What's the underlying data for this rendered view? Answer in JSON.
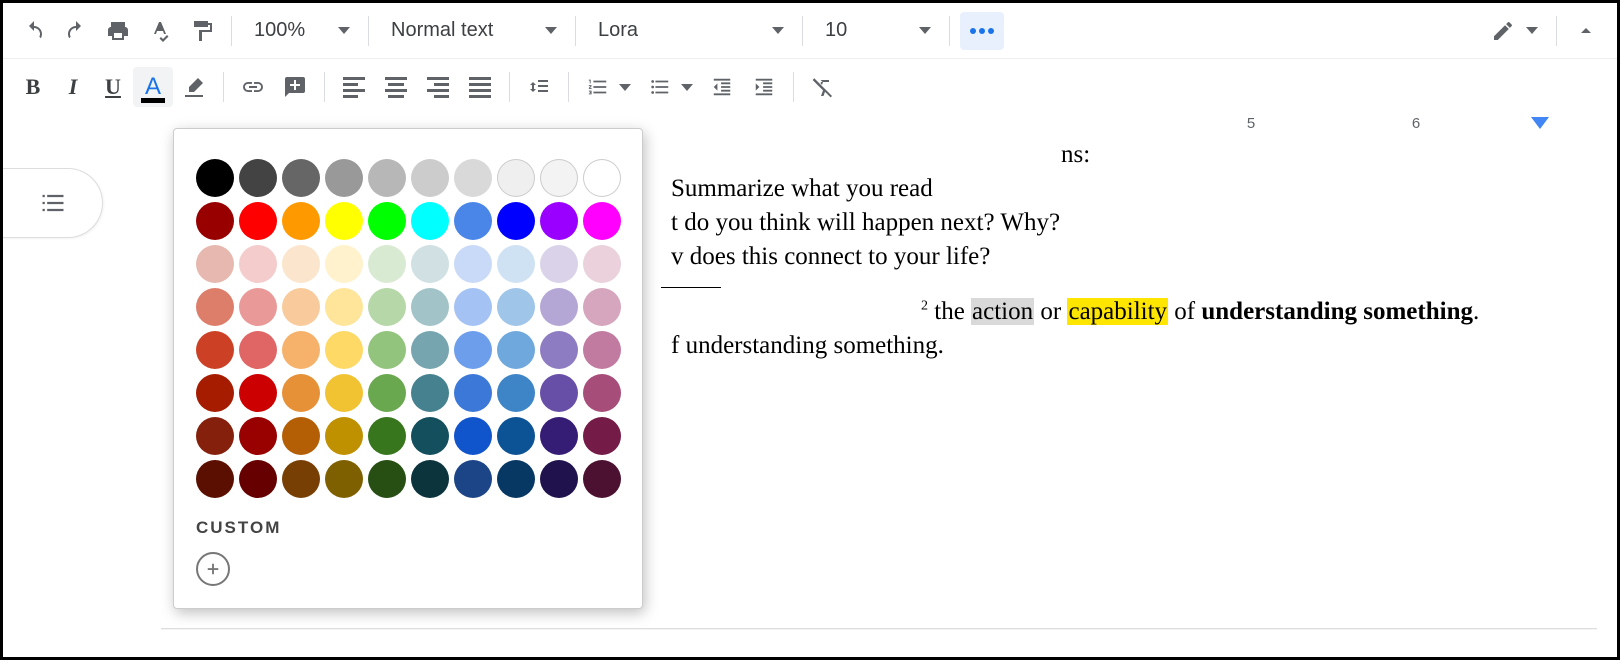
{
  "toolbar1": {
    "zoom": "100%",
    "style": "Normal text",
    "font": "Lora",
    "size": "10"
  },
  "ruler": {
    "marks": [
      "5",
      "6"
    ]
  },
  "doc": {
    "partial1": "ns:",
    "line1_suffix": "Summarize what you read",
    "line2_suffix": "t do you think will happen next? Why?",
    "line3_suffix": "v does this connect to your life?",
    "footnote_sup": "2",
    "footnote_text_pre": " the ",
    "footnote_action": "action",
    "footnote_or": " or ",
    "footnote_cap": "capability",
    "footnote_of": " of ",
    "footnote_bold": "understanding something",
    "footnote_period": ".",
    "line5_suffix": "f understanding something."
  },
  "popup": {
    "custom_label": "CUSTOM",
    "colors": [
      [
        "#000000",
        "#434343",
        "#666666",
        "#999999",
        "#b7b7b7",
        "#cccccc",
        "#d9d9d9",
        "#efefef",
        "#f3f3f3",
        "#ffffff"
      ],
      [
        "#980000",
        "#ff0000",
        "#ff9900",
        "#ffff00",
        "#00ff00",
        "#00ffff",
        "#4a86e8",
        "#0000ff",
        "#9900ff",
        "#ff00ff"
      ],
      [
        "#e6b8af",
        "#f4cccc",
        "#fce5cd",
        "#fff2cc",
        "#d9ead3",
        "#d0e0e3",
        "#c9daf8",
        "#cfe2f3",
        "#d9d2e9",
        "#ead1dc"
      ],
      [
        "#dd7e6b",
        "#ea9999",
        "#f9cb9c",
        "#ffe599",
        "#b6d7a8",
        "#a2c4c9",
        "#a4c2f4",
        "#9fc5e8",
        "#b4a7d6",
        "#d5a6bd"
      ],
      [
        "#cc4125",
        "#e06666",
        "#f6b26b",
        "#ffd966",
        "#93c47d",
        "#76a5af",
        "#6d9eeb",
        "#6fa8dc",
        "#8e7cc3",
        "#c27ba0"
      ],
      [
        "#a61c00",
        "#cc0000",
        "#e69138",
        "#f1c232",
        "#6aa84f",
        "#45818e",
        "#3c78d8",
        "#3d85c6",
        "#674ea7",
        "#a64d79"
      ],
      [
        "#85200c",
        "#990000",
        "#b45f06",
        "#bf9000",
        "#38761d",
        "#134f5c",
        "#1155cc",
        "#0b5394",
        "#351c75",
        "#741b47"
      ],
      [
        "#5b0f00",
        "#660000",
        "#783f04",
        "#7f6000",
        "#274e13",
        "#0c343d",
        "#1c4587",
        "#073763",
        "#20124d",
        "#4c1130"
      ]
    ]
  }
}
